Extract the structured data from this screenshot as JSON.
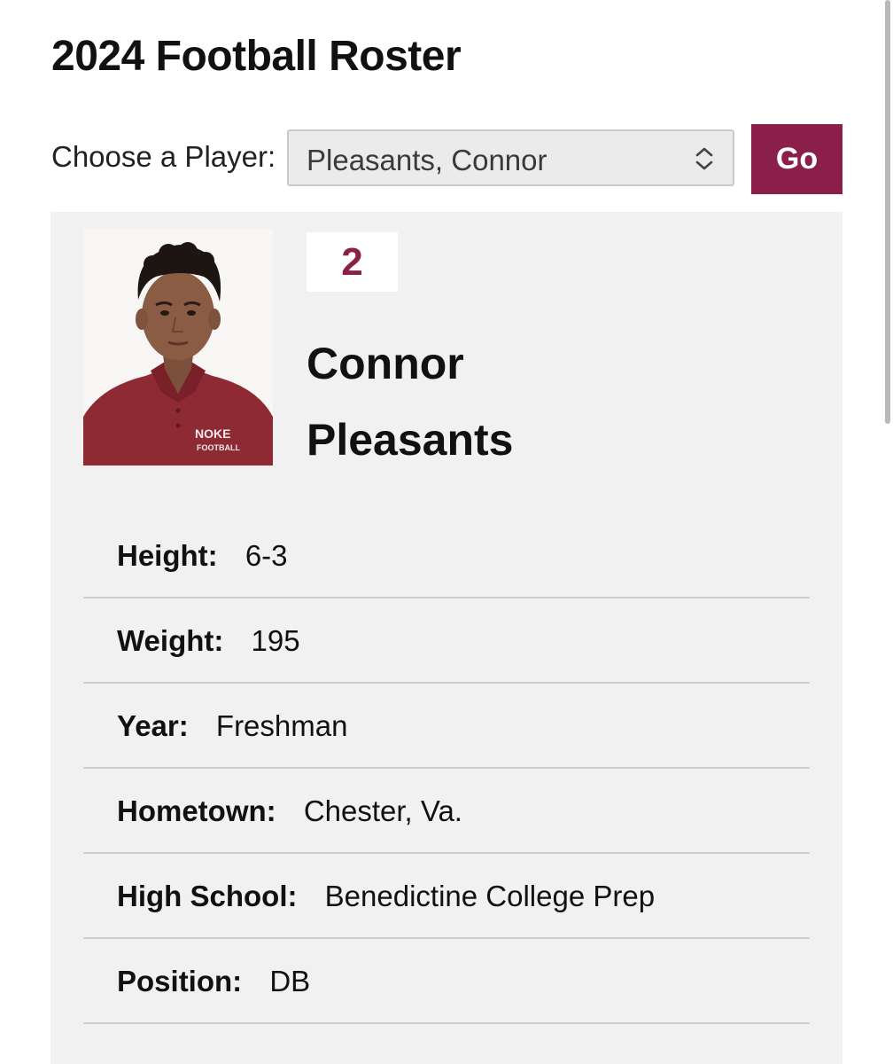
{
  "header": {
    "title": "2024 Football Roster"
  },
  "chooser": {
    "label": "Choose a Player:",
    "selected": "Pleasants, Connor",
    "go_label": "Go"
  },
  "player": {
    "number": "2",
    "first_name": "Connor",
    "last_name": "Pleasants",
    "photo_shirt_text_line1": "NOKE",
    "photo_shirt_text_line2": "FOOTBALL",
    "details": [
      {
        "label": "Height:",
        "value": "6-3"
      },
      {
        "label": "Weight:",
        "value": "195"
      },
      {
        "label": "Year:",
        "value": "Freshman"
      },
      {
        "label": "Hometown:",
        "value": "Chester, Va."
      },
      {
        "label": "High School:",
        "value": "Benedictine College Prep"
      },
      {
        "label": "Position:",
        "value": "DB"
      }
    ]
  },
  "colors": {
    "accent": "#8a1f4a",
    "card_background": "#f1f1f1",
    "select_background": "#ebebeb"
  },
  "icons": {
    "select": "chevron-up-down-icon"
  }
}
